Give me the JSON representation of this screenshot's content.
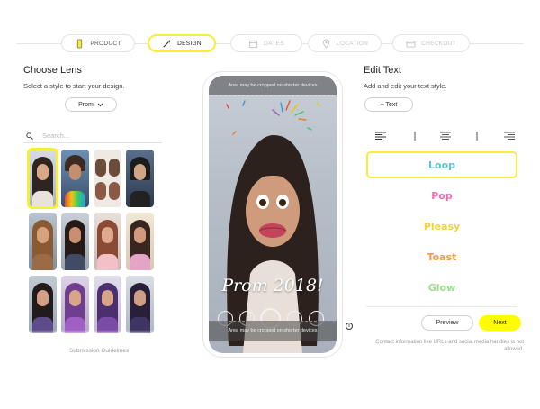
{
  "stepper": {
    "steps": [
      {
        "label": "PRODUCT",
        "icon": "phone-icon"
      },
      {
        "label": "DESIGN",
        "icon": "magic-wand-icon"
      },
      {
        "label": "DATES",
        "icon": "calendar-icon"
      },
      {
        "label": "LOCATION",
        "icon": "map-pin-icon"
      },
      {
        "label": "CHECKOUT",
        "icon": "credit-card-icon"
      }
    ],
    "active_index": 1,
    "accent": "#f7ee3a"
  },
  "lens": {
    "title": "Choose Lens",
    "subtitle": "Select a style to start your design.",
    "category": "Prom",
    "search_placeholder": "Search...",
    "selected_index": 0,
    "footer_link": "Submission Guidelines"
  },
  "preview": {
    "crop_top": "Area may be cropped on shorter devices",
    "crop_bottom": "Area may be cropped on shorter devices",
    "overlay_text": "Prom 2018!"
  },
  "text": {
    "title": "Edit Text",
    "subtitle": "Add and edit your text style.",
    "add_button": "+ Text",
    "styles": [
      {
        "label": "Loop",
        "color": "#5bc4d8"
      },
      {
        "label": "Pop",
        "color": "#f06bb4"
      },
      {
        "label": "Pleasy",
        "color": "#f3d23a"
      },
      {
        "label": "Toast",
        "color": "#f39a3e"
      },
      {
        "label": "Glow",
        "color": "#9be08f"
      }
    ],
    "selected_style": 0,
    "preview_button": "Preview",
    "next_button": "Next",
    "note": "Contact information like URLs and social media handles is not allowed."
  }
}
